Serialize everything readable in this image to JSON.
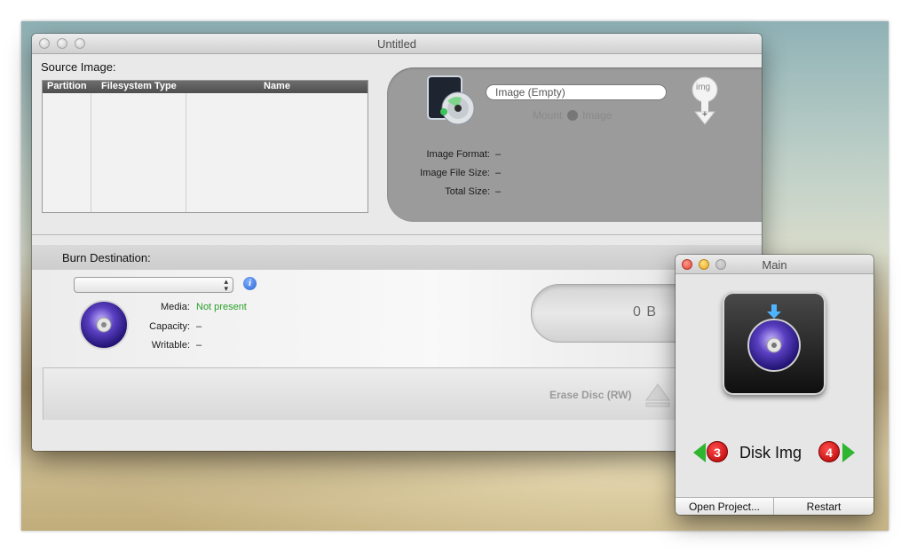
{
  "main_window": {
    "title": "Untitled",
    "source_image": {
      "label": "Source Image:",
      "table_columns": [
        "Partition",
        "Filesystem Type",
        "Name"
      ],
      "image_field": {
        "value": "Image (Empty)"
      },
      "mount_button": {
        "prefix": "Mount",
        "suffix": "Image"
      },
      "image_button_label": "img",
      "info": [
        {
          "label": "Image Format:",
          "value": "–"
        },
        {
          "label": "Image File Size:",
          "value": "–"
        },
        {
          "label": "Total Size:",
          "value": "–"
        }
      ]
    },
    "burn": {
      "label": "Burn Destination:",
      "device_select": "",
      "info_button": "i",
      "media": {
        "label": "Media:",
        "value": "Not present",
        "value_color": "#2aa12a"
      },
      "capacity": {
        "label": "Capacity:",
        "value": "–"
      },
      "writable": {
        "label": "Writable:",
        "value": "–"
      },
      "size_display": "0 B",
      "erase_button": "Erase Disc (RW)"
    }
  },
  "small_window": {
    "title": "Main",
    "app_name": "Disk Img",
    "prev_badge": "3",
    "next_badge": "4",
    "buttons": {
      "open": "Open Project...",
      "restart": "Restart"
    }
  },
  "icons": [
    "disc-image-icon",
    "purple-cd-icon",
    "add-image-icon",
    "eject-icon",
    "info-icon"
  ],
  "colors": {
    "accent_green": "#2aa12a",
    "badge_red": "#c40000",
    "panel_gray": "#9b9b9b"
  }
}
